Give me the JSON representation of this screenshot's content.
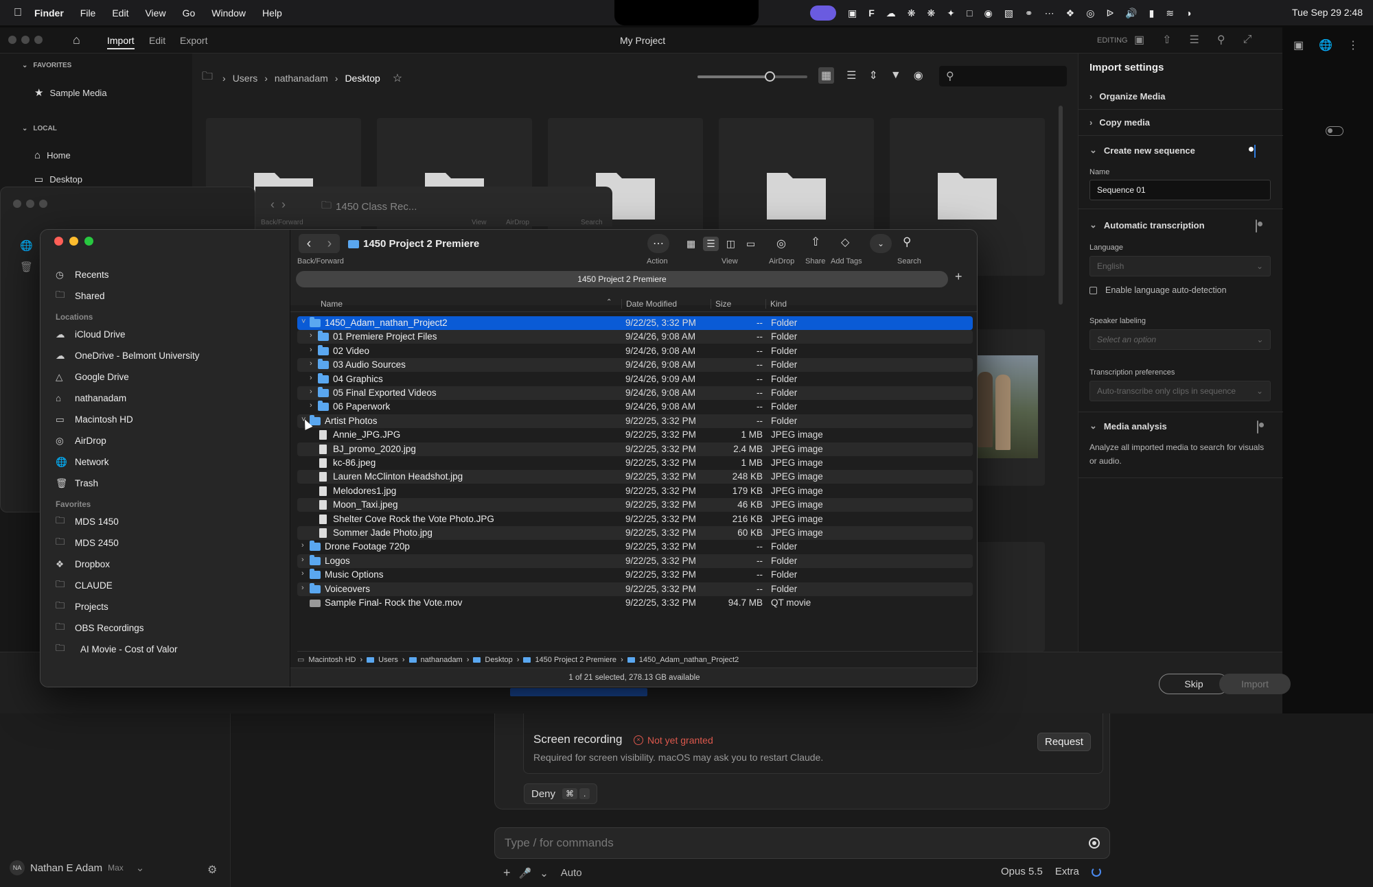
{
  "menubar": {
    "app": "Finder",
    "items": [
      "File",
      "Edit",
      "View",
      "Go",
      "Window",
      "Help"
    ],
    "clock": "Tue Sep 29  2:48"
  },
  "premiere": {
    "tabs": [
      "Import",
      "Edit",
      "Export"
    ],
    "title": "My Project",
    "editing_label": "EDITING",
    "sidebar": {
      "favorites_header": "FAVORITES",
      "favorites": [
        "Sample Media"
      ],
      "local_header": "LOCAL",
      "local": [
        "Home",
        "Desktop"
      ]
    },
    "breadcrumb": [
      "Users",
      "nathanadam",
      "Desktop"
    ],
    "import_settings": {
      "title": "Import settings",
      "organize": "Organize Media",
      "copy": "Copy media",
      "create_seq": "Create new sequence",
      "name_label": "Name",
      "name_value": "Sequence 01",
      "auto_trans": "Automatic transcription",
      "language_label": "Language",
      "language_value": "English",
      "lang_detect": "Enable language auto-detection",
      "speaker_label": "Speaker labeling",
      "speaker_value": "Select an option",
      "trans_pref_label": "Transcription preferences",
      "trans_pref_value": "Auto-transcribe only clips in sequence",
      "media_analysis": "Media analysis",
      "media_analysis_desc": "Analyze all imported media to search for visuals or audio."
    },
    "skip": "Skip",
    "import": "Import"
  },
  "finder_back": {
    "title": "1450 Class Rec...",
    "captions": [
      "Back/Forward",
      "View",
      "AirDrop",
      "Search"
    ]
  },
  "finder": {
    "title": "1450 Project 2 Premiere",
    "path_tab": "1450 Project 2 Premiere",
    "toolbar": {
      "back_forward": "Back/Forward",
      "action": "Action",
      "view": "View",
      "airdrop": "AirDrop",
      "share": "Share",
      "add_tags": "Add Tags",
      "search": "Search"
    },
    "sidebar": {
      "top": [
        "Recents",
        "Shared"
      ],
      "locations_header": "Locations",
      "locations": [
        "iCloud Drive",
        "OneDrive - Belmont University",
        "Google Drive",
        "nathanadam",
        "Macintosh HD",
        "AirDrop",
        "Network",
        "Trash"
      ],
      "favorites_header": "Favorites",
      "favorites": [
        "MDS 1450",
        "MDS 2450",
        "Dropbox",
        "CLAUDE",
        "Projects",
        "OBS Recordings",
        "AI Movie - Cost of Valor"
      ]
    },
    "columns": {
      "name": "Name",
      "date": "Date Modified",
      "size": "Size",
      "kind": "Kind"
    },
    "rows": [
      {
        "name": "1450_Adam_nathan_Project2",
        "date": "9/22/25, 3:32 PM",
        "size": "--",
        "kind": "Folder"
      },
      {
        "name": "01 Premiere Project Files",
        "date": "9/24/26, 9:08 AM",
        "size": "--",
        "kind": "Folder"
      },
      {
        "name": "02 Video",
        "date": "9/24/26, 9:08 AM",
        "size": "--",
        "kind": "Folder"
      },
      {
        "name": "03 Audio Sources",
        "date": "9/24/26, 9:08 AM",
        "size": "--",
        "kind": "Folder"
      },
      {
        "name": "04 Graphics",
        "date": "9/24/26, 9:09 AM",
        "size": "--",
        "kind": "Folder"
      },
      {
        "name": "05 Final Exported Videos",
        "date": "9/24/26, 9:08 AM",
        "size": "--",
        "kind": "Folder"
      },
      {
        "name": "06 Paperwork",
        "date": "9/24/26, 9:08 AM",
        "size": "--",
        "kind": "Folder"
      },
      {
        "name": "Artist Photos",
        "date": "9/22/25, 3:32 PM",
        "size": "--",
        "kind": "Folder"
      },
      {
        "name": "Annie_JPG.JPG",
        "date": "9/22/25, 3:32 PM",
        "size": "1 MB",
        "kind": "JPEG image"
      },
      {
        "name": "BJ_promo_2020.jpg",
        "date": "9/22/25, 3:32 PM",
        "size": "2.4 MB",
        "kind": "JPEG image"
      },
      {
        "name": "kc-86.jpeg",
        "date": "9/22/25, 3:32 PM",
        "size": "1 MB",
        "kind": "JPEG image"
      },
      {
        "name": "Lauren McClinton Headshot.jpg",
        "date": "9/22/25, 3:32 PM",
        "size": "248 KB",
        "kind": "JPEG image"
      },
      {
        "name": "Melodores1.jpg",
        "date": "9/22/25, 3:32 PM",
        "size": "179 KB",
        "kind": "JPEG image"
      },
      {
        "name": "Moon_Taxi.jpeg",
        "date": "9/22/25, 3:32 PM",
        "size": "46 KB",
        "kind": "JPEG image"
      },
      {
        "name": "Shelter Cove Rock the Vote Photo.JPG",
        "date": "9/22/25, 3:32 PM",
        "size": "216 KB",
        "kind": "JPEG image"
      },
      {
        "name": "Sommer Jade Photo.jpg",
        "date": "9/22/25, 3:32 PM",
        "size": "60 KB",
        "kind": "JPEG image"
      },
      {
        "name": "Drone Footage 720p",
        "date": "9/22/25, 3:32 PM",
        "size": "--",
        "kind": "Folder"
      },
      {
        "name": "Logos",
        "date": "9/22/25, 3:32 PM",
        "size": "--",
        "kind": "Folder"
      },
      {
        "name": "Music Options",
        "date": "9/22/25, 3:32 PM",
        "size": "--",
        "kind": "Folder"
      },
      {
        "name": "Voiceovers",
        "date": "9/22/25, 3:32 PM",
        "size": "--",
        "kind": "Folder"
      },
      {
        "name": "Sample Final- Rock the Vote.mov",
        "date": "9/22/25, 3:32 PM",
        "size": "94.7 MB",
        "kind": "QT movie"
      }
    ],
    "pathbar": [
      "Macintosh HD",
      "Users",
      "nathanadam",
      "Desktop",
      "1450 Project 2 Premiere",
      "1450_Adam_nathan_Project2"
    ],
    "status": "1 of 21 selected, 278.13 GB available"
  },
  "claude": {
    "perm_title": "Screen recording",
    "perm_status": "Not yet granted",
    "perm_desc": "Required for screen visibility. macOS may ask you to restart Claude.",
    "request": "Request",
    "deny": "Deny",
    "deny_key1": "⌘",
    "deny_key2": ".",
    "input_placeholder": "Type / for commands",
    "auto": "Auto",
    "model": "Opus 5.5",
    "effort": "Extra",
    "user_initials": "NA",
    "user_name": "Nathan E Adam",
    "user_plan": "Max"
  }
}
